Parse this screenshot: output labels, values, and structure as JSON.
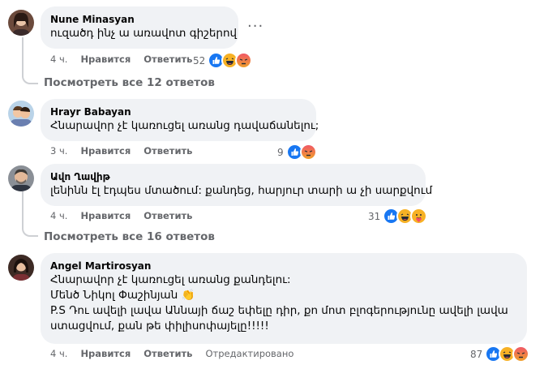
{
  "comments": [
    {
      "author": "Nune Minasyan",
      "lines": [
        "ուզածդ ինչ ա առավոտ գիշերով"
      ],
      "time": "4 ч.",
      "like_label": "Нравится",
      "reply_label": "Ответить",
      "reaction_count": "52",
      "reactions": [
        "like-icon",
        "haha-icon",
        "angry-icon"
      ],
      "view_replies": "Посмотреть все 12 ответов"
    },
    {
      "author": "Hrayr Babayan",
      "lines": [
        "Հնարավոր չէ կառուցել առանց դավաճանելու;"
      ],
      "time": "3 ч.",
      "like_label": "Нравится",
      "reply_label": "Ответить",
      "reaction_count": "9",
      "reactions": [
        "like-icon",
        "angry-icon"
      ]
    },
    {
      "author": "Ավո Ղավիթ",
      "lines": [
        "լենինն էլ էդպես մտածում: քանդեց, հարյուր տարի ա չի սարքվում"
      ],
      "time": "4 ч.",
      "like_label": "Нравится",
      "reply_label": "Ответить",
      "reaction_count": "31",
      "reactions": [
        "like-icon",
        "haha-icon",
        "care-icon"
      ],
      "view_replies": "Посмотреть все 16 ответов"
    },
    {
      "author": "Angel Martirosyan",
      "lines": [
        "Հնարավոր չէ կառուցել առանց քանդելու:",
        "Մենծ Նիկոլ Փաշինյան 👏",
        "P.S Դու ավելի լավա Աննայի ճաշ եփելը դիր, քո մոտ բլոգերությունը ավելի լավա",
        "ստացվում, քան թե փիլիսոփայելը!!!!!"
      ],
      "time": "4 ч.",
      "like_label": "Нравится",
      "reply_label": "Ответить",
      "edited_label": "Отредактировано",
      "reaction_count": "87",
      "reactions": [
        "like-icon",
        "haha-icon",
        "angry-icon"
      ]
    }
  ],
  "colors": {
    "bubble": "#f0f2f5",
    "secondary_text": "#65676b",
    "like_blue": "#1877f2",
    "haha_yellow": "#f7b125",
    "angry_red": "#e9710f"
  }
}
